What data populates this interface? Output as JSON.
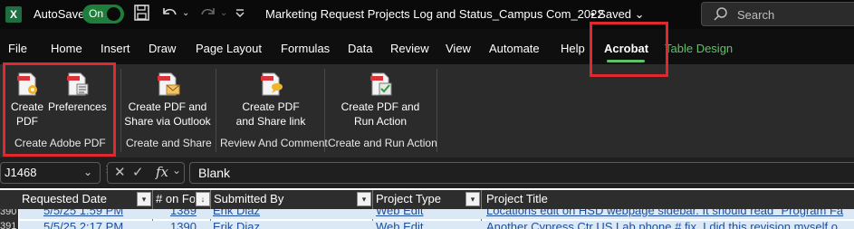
{
  "titlebar": {
    "app_icon": "excel-logo",
    "app_letter": "X",
    "autosave_label": "AutoSave",
    "autosave_state": "On",
    "doc_title": "Marketing Request Projects Log and Status_Campus Com_2022",
    "save_status": "• Saved",
    "search_placeholder": "Search",
    "icons": [
      "save-icon",
      "undo-icon",
      "redo-icon",
      "customize-quick-access-icon",
      "search-icon"
    ]
  },
  "menu": {
    "tabs": [
      {
        "label": "File"
      },
      {
        "label": "Home"
      },
      {
        "label": "Insert"
      },
      {
        "label": "Draw"
      },
      {
        "label": "Page Layout"
      },
      {
        "label": "Formulas"
      },
      {
        "label": "Data"
      },
      {
        "label": "Review"
      },
      {
        "label": "View"
      },
      {
        "label": "Automate"
      },
      {
        "label": "Help"
      },
      {
        "label": "Acrobat"
      },
      {
        "label": "Table Design"
      }
    ],
    "active_tab": "Acrobat",
    "accent_color": "#5ec26a"
  },
  "ribbon": {
    "groups": [
      {
        "label": "Create Adobe PDF",
        "buttons": [
          {
            "line1": "Create",
            "line2": "PDF",
            "icon": "create-pdf-icon"
          },
          {
            "line1": "Preferences",
            "line2": "",
            "icon": "preferences-icon"
          }
        ]
      },
      {
        "label": "Create and Share",
        "buttons": [
          {
            "line1": "Create PDF and",
            "line2": "Share via Outlook",
            "icon": "pdf-outlook-icon"
          }
        ]
      },
      {
        "label": "Review And Comment",
        "buttons": [
          {
            "line1": "Create PDF",
            "line2": "and Share link",
            "icon": "pdf-share-link-icon"
          }
        ]
      },
      {
        "label": "Create and Run Action",
        "buttons": [
          {
            "line1": "Create PDF and",
            "line2": "Run Action",
            "icon": "pdf-run-action-icon"
          }
        ]
      }
    ],
    "highlight_color": "#e0282e"
  },
  "formula_bar": {
    "name_box": "J1468",
    "formula_value": "Blank",
    "icons": [
      "name-box-dropdown-icon",
      "more-options-icon",
      "cancel-icon",
      "enter-icon",
      "fx-icon",
      "expand-formula-icon"
    ]
  },
  "grid": {
    "headers": [
      "Requested Date",
      "# on Fo",
      "Submitted By",
      "Project Type",
      "Project Title"
    ],
    "rows": [
      {
        "row_num": "390",
        "cells": [
          "5/5/25 1:59 PM",
          "1389",
          "Erik Diaz",
          "Web Edit",
          "Locations edit on HSD webpage sidebar. It should read \"Program Fa"
        ]
      },
      {
        "row_num": "391",
        "cells": [
          "5/5/25 2:17 PM",
          "1390",
          "Erik Diaz",
          "Web Edit",
          "Another Cypress Ctr US Lab phone # fix. I did this revision myself o"
        ]
      }
    ]
  }
}
